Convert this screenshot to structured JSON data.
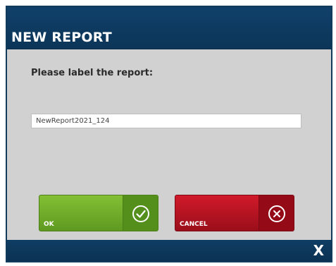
{
  "dialog": {
    "title": "NEW REPORT",
    "prompt": "Please label the report:",
    "report_name_value": "NewReport2021_124",
    "ok_label": "OK",
    "cancel_label": "CANCEL",
    "close_label": "X"
  },
  "colors": {
    "titlebar": "#10406a",
    "body": "#d1d1d1",
    "ok": "#6fae2a",
    "cancel": "#c0152a"
  },
  "icons": {
    "ok": "check-circle-icon",
    "cancel": "x-circle-icon",
    "close": "close-icon"
  }
}
